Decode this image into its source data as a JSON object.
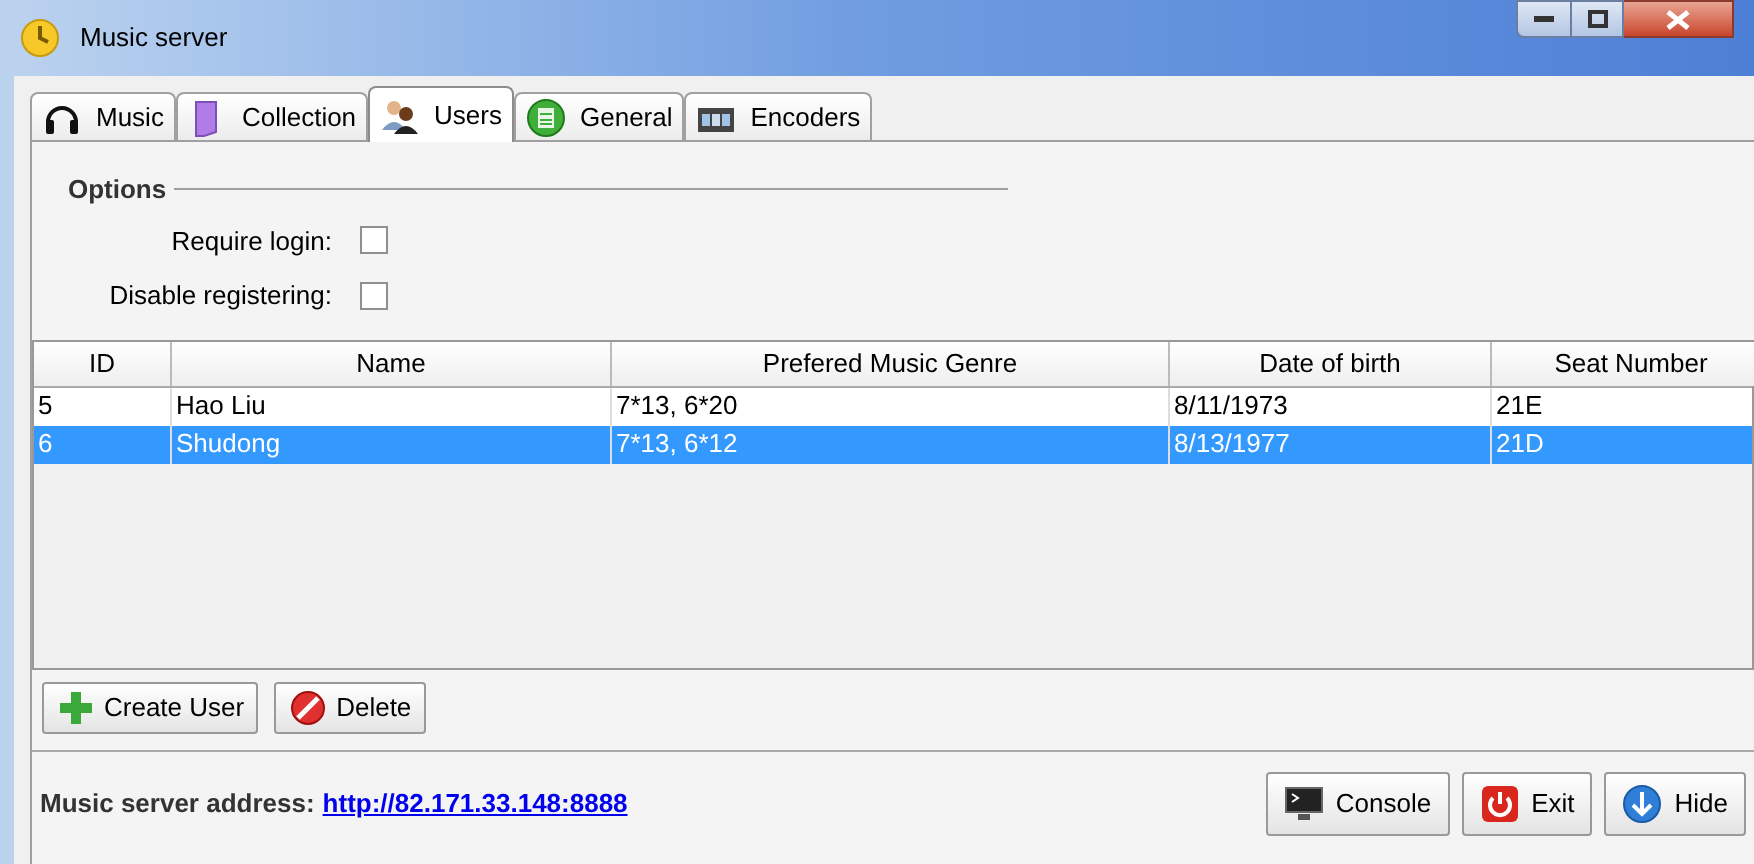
{
  "window": {
    "title": "Music server"
  },
  "tabs": [
    {
      "label": "Music",
      "selected": false
    },
    {
      "label": "Collection",
      "selected": false
    },
    {
      "label": "Users",
      "selected": true
    },
    {
      "label": "General",
      "selected": false
    },
    {
      "label": "Encoders",
      "selected": false
    }
  ],
  "options": {
    "title": "Options",
    "checkboxes": [
      {
        "label": "Require login:",
        "checked": false
      },
      {
        "label": "Disable registering:",
        "checked": false
      }
    ]
  },
  "table": {
    "columns": [
      "ID",
      "Name",
      "Prefered Music Genre",
      "Date of birth",
      "Seat Number"
    ],
    "rows": [
      {
        "cells": [
          "5",
          "Hao Liu",
          "7*13, 6*20",
          "8/11/1973",
          "21E"
        ],
        "selected": false
      },
      {
        "cells": [
          "6",
          "Shudong",
          "7*13, 6*12",
          "8/13/1977",
          "21D"
        ],
        "selected": true
      }
    ]
  },
  "actions": [
    {
      "label": "Create User"
    },
    {
      "label": "Delete"
    }
  ],
  "status_bar": {
    "label": "Music server address:",
    "link": "http://82.171.33.148:8888",
    "buttons": [
      {
        "label": "Console"
      },
      {
        "label": "Exit"
      },
      {
        "label": "Hide"
      }
    ]
  }
}
